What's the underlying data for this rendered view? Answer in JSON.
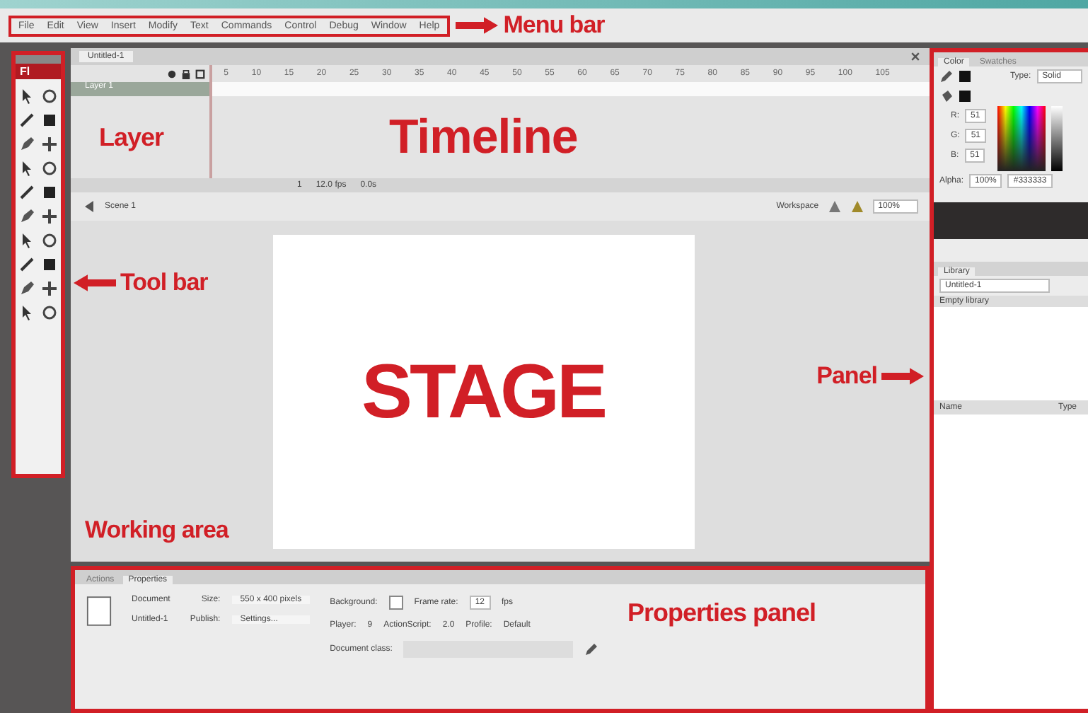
{
  "menu_bar": {
    "items": [
      "File",
      "Edit",
      "View",
      "Insert",
      "Modify",
      "Text",
      "Commands",
      "Control",
      "Debug",
      "Window",
      "Help"
    ],
    "annotation": "Menu bar"
  },
  "toolbar": {
    "logo": "Fl",
    "annotation": "Tool bar"
  },
  "document": {
    "tab": "Untitled-1"
  },
  "timeline": {
    "annotation": "Timeline",
    "layer_annotation": "Layer",
    "frame_numbers": [
      "5",
      "10",
      "15",
      "20",
      "25",
      "30",
      "35",
      "40",
      "45",
      "50",
      "55",
      "60",
      "65",
      "70",
      "75",
      "80",
      "85",
      "90",
      "95",
      "100",
      "105"
    ],
    "layers": [
      {
        "name": "Layer 1",
        "selected": true
      }
    ],
    "footer": [
      "1",
      "12.0 fps",
      "0.0s"
    ]
  },
  "edit_bar": {
    "scene": "Scene 1",
    "workspace": "Workspace",
    "zoom": "100%"
  },
  "working_area": {
    "annotation": "Working area",
    "panel_annotation": "Panel",
    "stage_label": "STAGE"
  },
  "properties": {
    "tabs": [
      {
        "label": "Actions",
        "selected": false
      },
      {
        "label": "Properties",
        "selected": true
      }
    ],
    "annotation": "Properties panel",
    "document_label": "Document",
    "document_name": "Untitled-1",
    "size_label": "Size:",
    "size": "550 x 400 pixels",
    "publish_label": "Publish:",
    "publish_button": "Settings...",
    "background_label": "Background:",
    "frame_rate_label": "Frame rate:",
    "frame_rate": "12",
    "fps": "fps",
    "player_label": "Player:",
    "player": "9",
    "actionscript_label": "ActionScript:",
    "actionscript": "2.0",
    "profile_label": "Profile:",
    "profile": "Default",
    "class_label": "Document class:"
  },
  "color_panel": {
    "tabs": [
      {
        "label": "Color",
        "selected": true
      },
      {
        "label": "Swatches",
        "selected": false
      }
    ],
    "type_label": "Type:",
    "type": "Solid",
    "channels": [
      {
        "label": "R:",
        "value": "51"
      },
      {
        "label": "G:",
        "value": "51"
      },
      {
        "label": "B:",
        "value": "51"
      }
    ],
    "alpha_label": "Alpha:",
    "alpha": "100%",
    "hex": "#333333"
  },
  "library": {
    "tabs": [
      {
        "label": "Library",
        "selected": true
      }
    ],
    "document": "Untitled-1",
    "empty": "Empty library",
    "columns": [
      "Name",
      "Type"
    ]
  }
}
